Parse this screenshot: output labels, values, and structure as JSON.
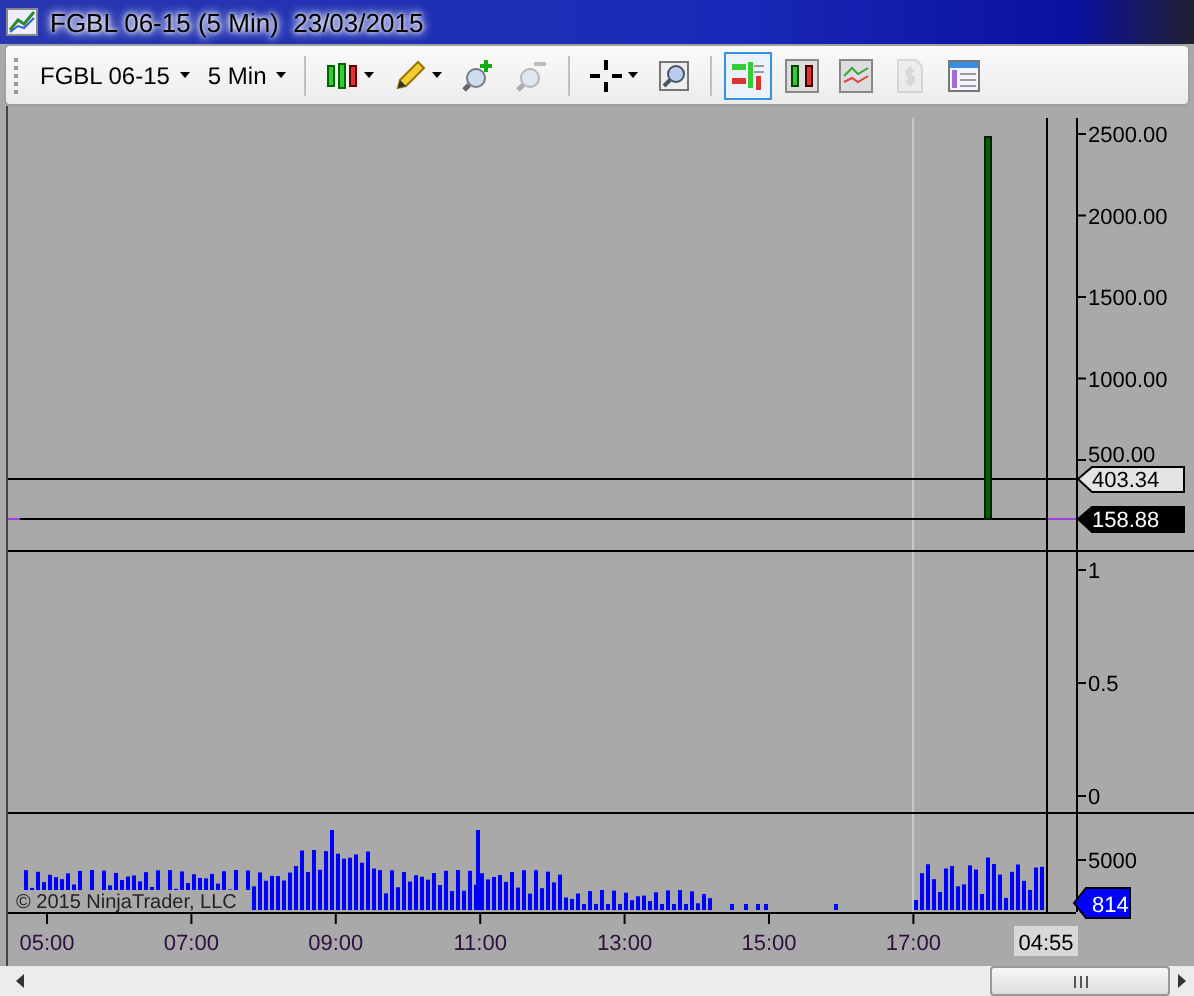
{
  "window": {
    "title": "FGBL 06-15 (5 Min)  23/03/2015"
  },
  "toolbar": {
    "instrument": "FGBL 06-15",
    "interval": "5 Min",
    "buttons": [
      {
        "kind": "candles",
        "caret": true,
        "selected": false,
        "disabled": false
      },
      {
        "kind": "pencil",
        "caret": true,
        "selected": false,
        "disabled": false
      },
      {
        "kind": "zoom-in",
        "caret": false,
        "selected": false,
        "disabled": false
      },
      {
        "kind": "zoom-out",
        "caret": false,
        "selected": false,
        "disabled": true
      },
      {
        "kind": "separator"
      },
      {
        "kind": "crosshair",
        "caret": true,
        "selected": false,
        "disabled": false
      },
      {
        "kind": "magnifier",
        "caret": false,
        "selected": false,
        "disabled": false
      },
      {
        "kind": "separator"
      },
      {
        "kind": "chart-trader",
        "caret": false,
        "selected": true,
        "disabled": false
      },
      {
        "kind": "bars",
        "caret": false,
        "selected": false,
        "disabled": false
      },
      {
        "kind": "line-chart",
        "caret": false,
        "selected": false,
        "disabled": false
      },
      {
        "kind": "dollar",
        "caret": false,
        "selected": false,
        "disabled": true
      },
      {
        "kind": "data-box",
        "caret": false,
        "selected": false,
        "disabled": false
      }
    ]
  },
  "chart": {
    "price_axis": [
      "2500.00",
      "2000.00",
      "1500.00",
      "1000.00",
      "500.00"
    ],
    "price_labels": [
      {
        "text": "403.34",
        "kind": "marker"
      },
      {
        "text": "158.88",
        "kind": "last"
      }
    ],
    "indicator_axis": [
      "1",
      "0.5",
      "0"
    ],
    "volume_axis": [
      "5000"
    ],
    "volume_label": "814",
    "time_axis": [
      "05:00",
      "07:00",
      "09:00",
      "11:00",
      "13:00",
      "15:00",
      "17:00"
    ],
    "cursor_time": "04:55",
    "copyright": "© 2015 NinjaTrader, LLC"
  }
}
